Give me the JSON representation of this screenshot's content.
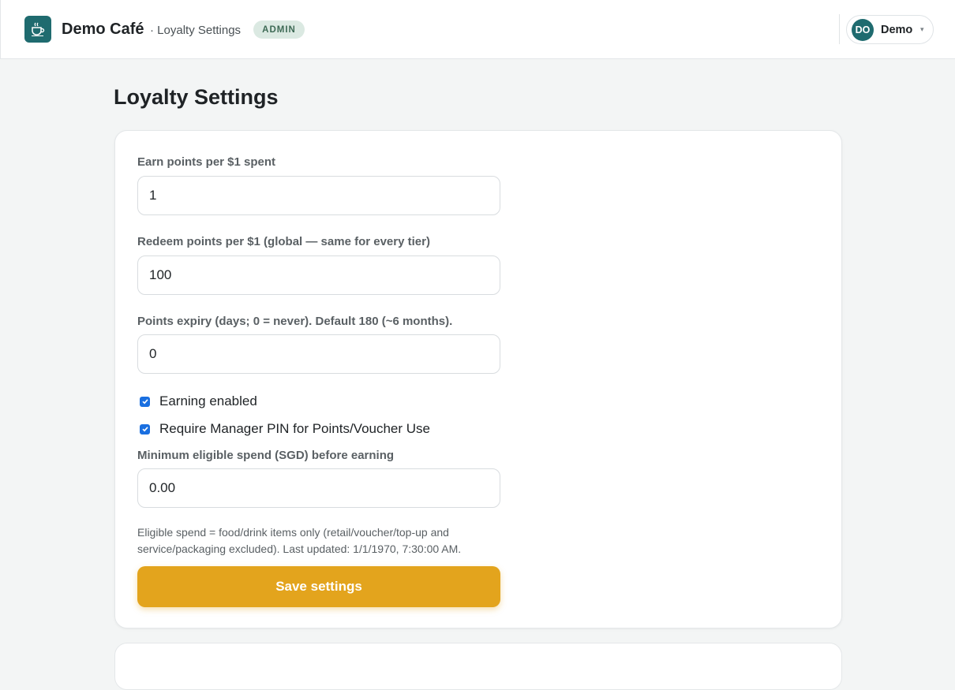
{
  "header": {
    "brand": "Demo Café",
    "crumb": "· Loyalty Settings",
    "badge": "ADMIN",
    "logo_icon": "coffee-cup-icon",
    "user": {
      "initials": "DO",
      "name": "Demo"
    }
  },
  "page": {
    "title": "Loyalty Settings"
  },
  "form": {
    "earn": {
      "label": "Earn points per $1 spent",
      "value": "1"
    },
    "redeem": {
      "label": "Redeem points per $1 (global — same for every tier)",
      "value": "100"
    },
    "expiry": {
      "label": "Points expiry (days; 0 = never). Default 180 (~6 months).",
      "value": "0"
    },
    "earning_enabled": {
      "label": "Earning enabled",
      "checked": true
    },
    "require_pin": {
      "label": "Require Manager PIN for Points/Voucher Use",
      "checked": true
    },
    "min_spend": {
      "label": "Minimum eligible spend (SGD) before earning",
      "value": "0.00"
    },
    "help": "Eligible spend = food/drink items only (retail/voucher/top-up and service/packaging excluded). Last updated: 1/1/1970, 7:30:00 AM.",
    "save_label": "Save settings"
  },
  "colors": {
    "brand": "#1f6b6f",
    "accent": "#e3a41d",
    "checkbox": "#1a6fe0",
    "background": "#f3f5f5"
  }
}
